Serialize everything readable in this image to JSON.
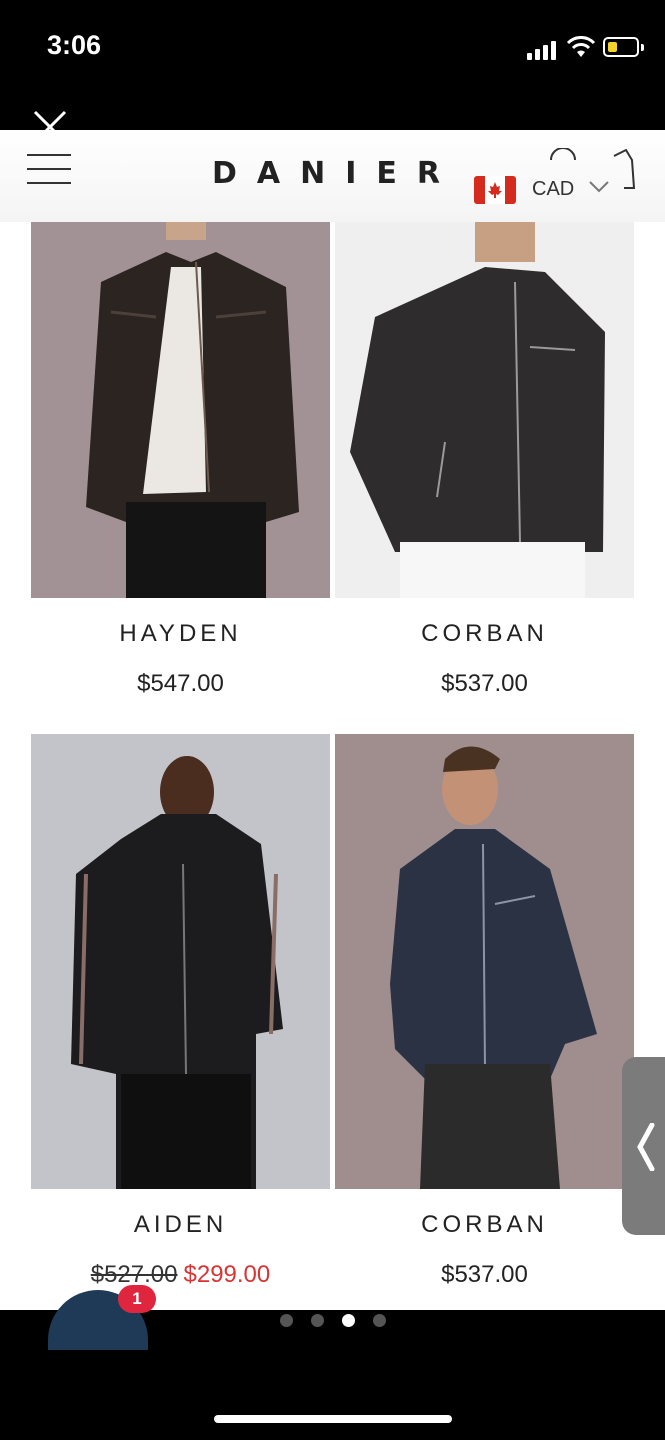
{
  "status_bar": {
    "time": "3:06"
  },
  "header": {
    "brand": "DANIER",
    "currency": "CAD",
    "flag_icon": "canada-flag-icon"
  },
  "products": [
    {
      "name": "HAYDEN",
      "price": "$547.00"
    },
    {
      "name": "CORBAN",
      "price": "$537.00"
    },
    {
      "name": "AIDEN",
      "original_price": "$527.00",
      "sale_price": "$299.00"
    },
    {
      "name": "CORBAN",
      "price": "$537.00"
    }
  ],
  "chat": {
    "badge_count": "1"
  },
  "pager": {
    "total": 4,
    "active": 3
  },
  "colors": {
    "sale": "#d93434",
    "chat": "#1e3a56",
    "badge": "#e0263f"
  }
}
